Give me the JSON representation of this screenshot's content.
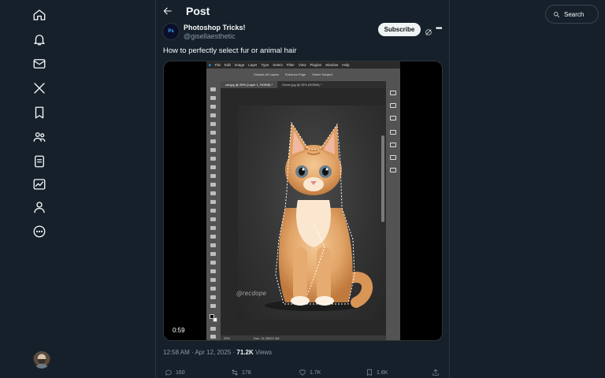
{
  "header": {
    "title": "Post"
  },
  "nav": {
    "items": [
      "home-icon",
      "notifications-icon",
      "messages-icon",
      "x-logo-icon",
      "bookmarks-icon",
      "communities-icon",
      "lists-icon",
      "analytics-icon",
      "profile-icon",
      "more-circle-icon"
    ]
  },
  "post": {
    "author_name": "Photoshop Tricks!",
    "author_handle": "@gisellaesthetic",
    "avatar_text": "Ps",
    "subscribe_label": "Subscribe",
    "text": "How to perfectly select fur or animal hair",
    "video_time": "0:59",
    "timestamp": "12:58 AM · Apr 12, 2025 · ",
    "views_count": "71.2K",
    "views_label": " Views"
  },
  "photoshop": {
    "menu": [
      "File",
      "Edit",
      "Image",
      "Layer",
      "Type",
      "Select",
      "Filter",
      "View",
      "Plugins",
      "Window",
      "Help"
    ],
    "options": [
      "Sample All Layers",
      "Enhance Edge",
      "Select Subject"
    ],
    "tab_active": "cat.jpg @ 25% (Layer 1, RGB/8) *",
    "tab_inactive": "Green.jpg @ 25% (RGB/8) *",
    "zoom": "25%",
    "doc_info": "Doc: 11.2M/22.4M",
    "watermark": "@recdope"
  },
  "actions": {
    "replies": "160",
    "reposts": "178",
    "likes": "1.7K",
    "bookmarks": "1.6K"
  },
  "search": {
    "label": "Search"
  },
  "colors": {
    "background": "#15202b",
    "border": "#2f3336",
    "muted": "#8b98a5"
  }
}
